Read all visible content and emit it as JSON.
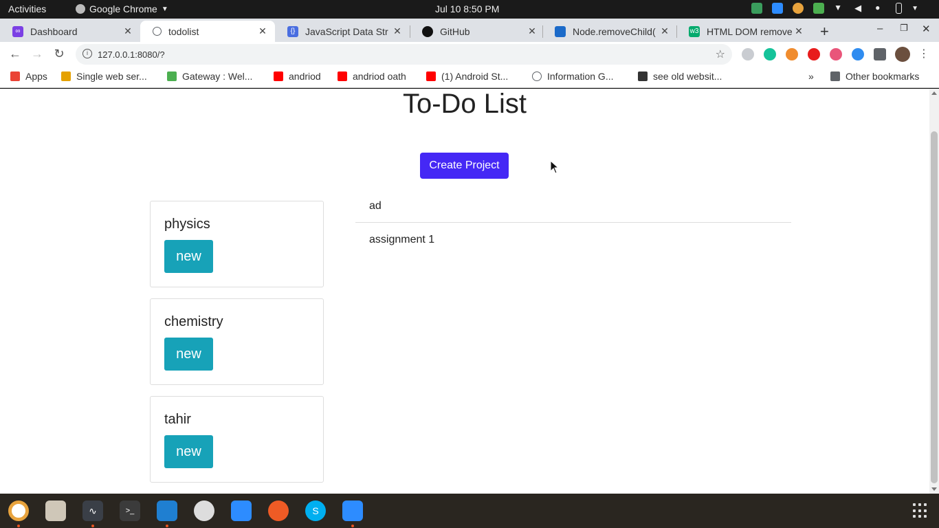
{
  "os": {
    "activities_label": "Activities",
    "app_menu_label": "Google Chrome",
    "clock": "Jul 10   8:50 PM"
  },
  "browser": {
    "tabs": [
      {
        "label": "Dashboard",
        "icon": "dashboard-favicon",
        "color": "#7b3fe4"
      },
      {
        "label": "todolist",
        "icon": "globe-icon",
        "color": "#5f6368",
        "active": true
      },
      {
        "label": "JavaScript Data Str",
        "icon": "code-favicon",
        "color": "#4a6ee0"
      },
      {
        "label": "GitHub",
        "icon": "github-icon",
        "color": "#111111"
      },
      {
        "label": "Node.removeChild(",
        "icon": "mdn-favicon",
        "color": "#1b6ac9"
      },
      {
        "label": "HTML DOM remove",
        "icon": "w3schools-favicon",
        "color": "#04aa6d"
      }
    ],
    "url": "127.0.0.1:8080/?",
    "bookmarks": [
      {
        "label": "Apps",
        "icon": "apps-grid-icon",
        "color": "#ea4335"
      },
      {
        "label": "Single web ser...",
        "icon": "bookmark-favicon",
        "color": "#e5a100"
      },
      {
        "label": "Gateway : Wel...",
        "icon": "bookmark-favicon",
        "color": "#4caf50"
      },
      {
        "label": "andriod",
        "icon": "youtube-icon",
        "color": "#ff0000"
      },
      {
        "label": "andriod oath",
        "icon": "youtube-icon",
        "color": "#ff0000"
      },
      {
        "label": "(1) Android St...",
        "icon": "youtube-icon",
        "color": "#ff0000"
      },
      {
        "label": "Information G...",
        "icon": "globe-icon",
        "color": "#5f6368"
      },
      {
        "label": "see old websit...",
        "icon": "archive-icon",
        "color": "#333333"
      }
    ],
    "overflow_label": "»",
    "other_bookmarks_label": "Other bookmarks"
  },
  "page": {
    "title": "To-Do List",
    "create_button_label": "Create Project",
    "projects": [
      {
        "name": "physics",
        "button_label": "new"
      },
      {
        "name": "chemistry",
        "button_label": "new"
      },
      {
        "name": "tahir",
        "button_label": "new"
      }
    ],
    "todos": [
      {
        "text": "ad"
      },
      {
        "text": "assignment 1"
      }
    ]
  },
  "colors": {
    "create_button": "#4528f5",
    "new_button": "#17a2b8"
  }
}
